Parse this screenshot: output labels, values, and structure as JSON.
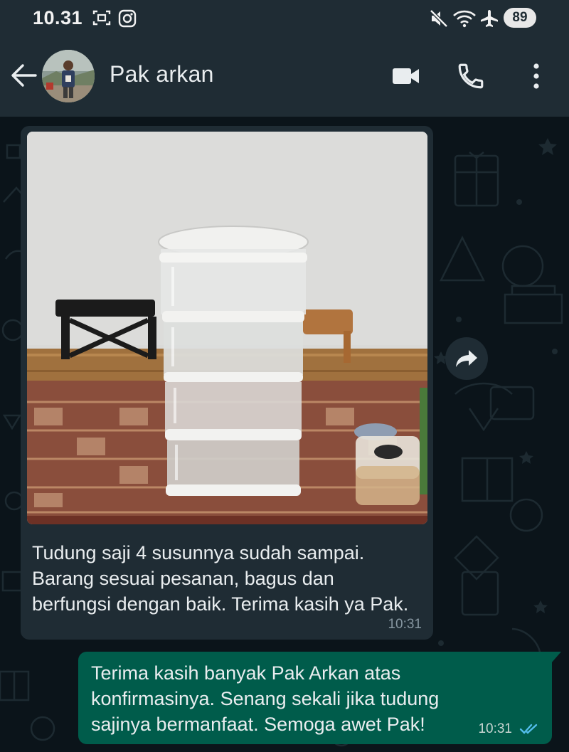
{
  "status_bar": {
    "time": "10.31",
    "battery": "89",
    "icons": [
      "screenshot-icon",
      "instagram-icon",
      "mute-icon",
      "wifi-icon",
      "airplane-icon"
    ]
  },
  "header": {
    "contact_name": "Pak arkan",
    "icons": [
      "back-arrow-icon",
      "avatar",
      "video-call-icon",
      "phone-icon",
      "more-options-icon"
    ]
  },
  "colors": {
    "app_bar": "#1f2c34",
    "chat_background": "#0b141a",
    "incoming_bubble": "#1f2c34",
    "outgoing_bubble": "#005c4b",
    "read_ticks": "#53bdeb"
  },
  "messages": {
    "incoming": {
      "text": "Tudung saji 4 susunnya sudah sampai. Barang sesuai pesanan, bagus dan berfungsi dengan baik. Terima kasih ya Pak.",
      "time": "10:31"
    },
    "outgoing": {
      "text": "Terima kasih banyak Pak Arkan atas konfirmasinya. Senang sekali jika tudung sajinya bermanfaat. Semoga awet Pak!",
      "time": "10:31",
      "status": "read"
    }
  }
}
